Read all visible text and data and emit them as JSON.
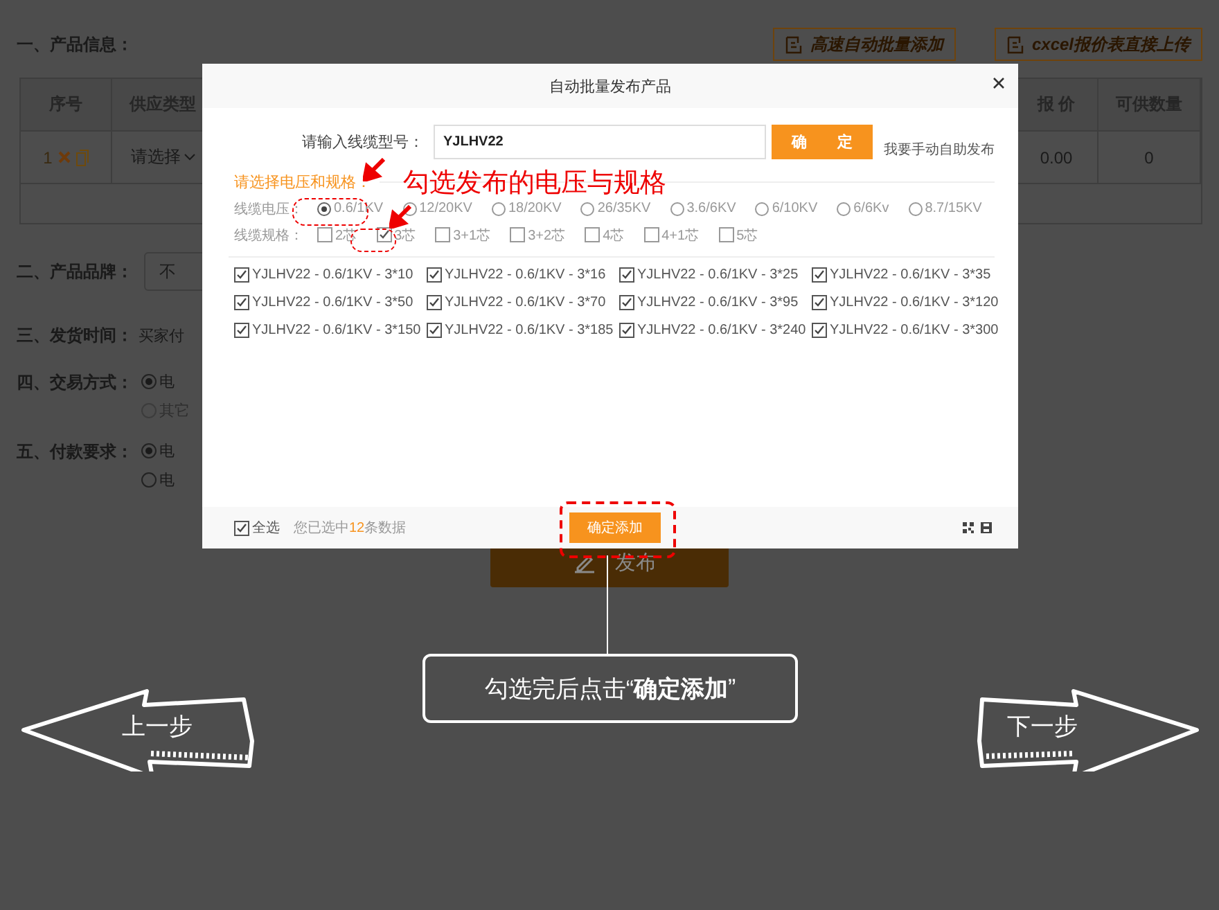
{
  "background_page": {
    "section_product_info": "一、产品信息：",
    "toolbar_buttons": [
      "高速自动批量添加",
      "cxcel报价表直接上传"
    ],
    "table": {
      "columns": [
        "序号",
        "供应类型",
        "报 价",
        "可供数量"
      ],
      "rows": [
        {
          "index": "1",
          "supply_type": "请选择",
          "price": "0.00",
          "quantity": "0"
        }
      ]
    },
    "brand": {
      "label": "二、产品品牌：",
      "placeholder": "不"
    },
    "delivery": {
      "label": "三、发货时间：",
      "value": "买家付"
    },
    "trade": {
      "label": "四、交易方式：",
      "options": [
        {
          "label": "电",
          "selected": true,
          "disabled": false
        },
        {
          "label": "其它",
          "selected": false,
          "disabled": true
        }
      ]
    },
    "payment": {
      "label": "五、付款要求：",
      "options": [
        {
          "label": "电",
          "selected": true,
          "disabled": false
        },
        {
          "label": "电",
          "selected": false,
          "disabled": false
        }
      ]
    },
    "publish_button": "发布"
  },
  "dialog": {
    "title": "自动批量发布产品",
    "model_label": "请输入线缆型号：",
    "model_value": "YJLHV22",
    "confirm_button": "确　　定",
    "manual_link": "我要手动自助发布",
    "section_label": "请选择电压和规格：",
    "voltage_label": "线缆电压：",
    "voltages": [
      {
        "label": "0.6/1KV",
        "selected": true
      },
      {
        "label": "12/20KV",
        "selected": false
      },
      {
        "label": "18/20KV",
        "selected": false
      },
      {
        "label": "26/35KV",
        "selected": false
      },
      {
        "label": "3.6/6KV",
        "selected": false
      },
      {
        "label": "6/10KV",
        "selected": false
      },
      {
        "label": "6/6Kv",
        "selected": false
      },
      {
        "label": "8.7/15KV",
        "selected": false
      }
    ],
    "spec_label": "线缆规格：",
    "specs": [
      {
        "label": "2芯",
        "checked": false
      },
      {
        "label": "3芯",
        "checked": true
      },
      {
        "label": "3+1芯",
        "checked": false
      },
      {
        "label": "3+2芯",
        "checked": false
      },
      {
        "label": "4芯",
        "checked": false
      },
      {
        "label": "4+1芯",
        "checked": false
      },
      {
        "label": "5芯",
        "checked": false
      }
    ],
    "products": [
      {
        "label": "YJLHV22 - 0.6/1KV - 3*10",
        "checked": true
      },
      {
        "label": "YJLHV22 - 0.6/1KV - 3*16",
        "checked": true
      },
      {
        "label": "YJLHV22 - 0.6/1KV - 3*25",
        "checked": true
      },
      {
        "label": "YJLHV22 - 0.6/1KV - 3*35",
        "checked": true
      },
      {
        "label": "YJLHV22 - 0.6/1KV - 3*50",
        "checked": true
      },
      {
        "label": "YJLHV22 - 0.6/1KV - 3*70",
        "checked": true
      },
      {
        "label": "YJLHV22 - 0.6/1KV - 3*95",
        "checked": true
      },
      {
        "label": "YJLHV22 - 0.6/1KV - 3*120",
        "checked": true
      },
      {
        "label": "YJLHV22 - 0.6/1KV - 3*150",
        "checked": true
      },
      {
        "label": "YJLHV22 - 0.6/1KV - 3*185",
        "checked": true
      },
      {
        "label": "YJLHV22 - 0.6/1KV - 3*240",
        "checked": true
      },
      {
        "label": "YJLHV22 - 0.6/1KV - 3*300",
        "checked": true
      }
    ],
    "select_all": {
      "label": "全选",
      "checked": true
    },
    "summary_prefix": "您已选中",
    "summary_count": "12",
    "summary_suffix": "条数据",
    "add_button": "确定添加"
  },
  "annotations": {
    "heading": "勾选发布的电压与规格",
    "callout": "勾选完后点击“**确定添加**”"
  },
  "nav": {
    "prev": "上一步",
    "next": "下一步"
  }
}
